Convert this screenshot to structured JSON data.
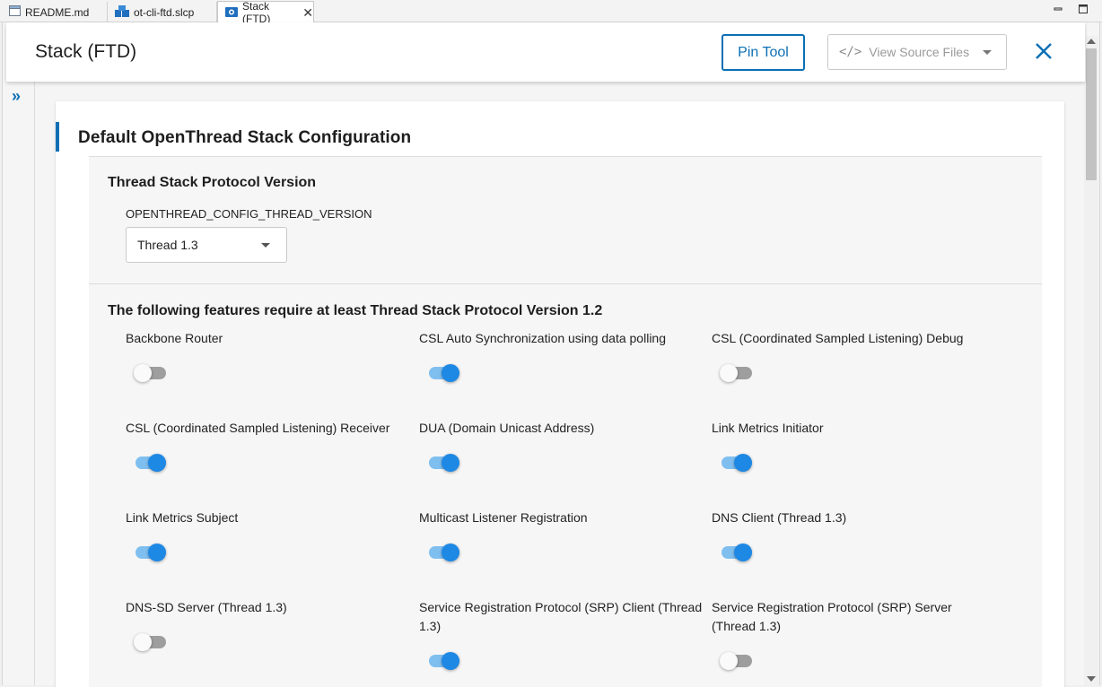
{
  "tabs": [
    {
      "label": "README.md",
      "icon": "file-icon",
      "active": false
    },
    {
      "label": "ot-cli-ftd.slcp",
      "icon": "project-icon",
      "active": false
    },
    {
      "label": "Stack (FTD)",
      "icon": "config-icon",
      "active": true
    }
  ],
  "header": {
    "title": "Stack (FTD)",
    "pin_tool_label": "Pin Tool",
    "view_source_label": "View Source Files"
  },
  "card": {
    "title": "Default OpenThread Stack Configuration"
  },
  "version_section": {
    "title": "Thread Stack Protocol Version",
    "field_label": "OPENTHREAD_CONFIG_THREAD_VERSION",
    "selected_value": "Thread 1.3"
  },
  "features_section": {
    "title": "The following features require at least Thread Stack Protocol Version 1.2",
    "features": [
      {
        "label": "Backbone Router",
        "enabled": false
      },
      {
        "label": "CSL Auto Synchronization using data polling",
        "enabled": true
      },
      {
        "label": "CSL (Coordinated Sampled Listening) Debug",
        "enabled": false
      },
      {
        "label": "CSL (Coordinated Sampled Listening) Receiver",
        "enabled": true
      },
      {
        "label": "DUA (Domain Unicast Address)",
        "enabled": true
      },
      {
        "label": "Link Metrics Initiator",
        "enabled": true
      },
      {
        "label": "Link Metrics Subject",
        "enabled": true
      },
      {
        "label": "Multicast Listener Registration",
        "enabled": true
      },
      {
        "label": "DNS Client (Thread 1.3)",
        "enabled": true
      },
      {
        "label": "DNS-SD Server (Thread 1.3)",
        "enabled": false
      },
      {
        "label": "Service Registration Protocol (SRP) Client (Thread 1.3)",
        "enabled": true
      },
      {
        "label": "Service Registration Protocol (SRP) Server (Thread 1.3)",
        "enabled": false
      }
    ]
  },
  "colors": {
    "accent": "#0c6fb5",
    "toggle_on": "#1e88e5",
    "toggle_on_track": "#7fbff0",
    "toggle_off_track": "#9e9e9e"
  }
}
